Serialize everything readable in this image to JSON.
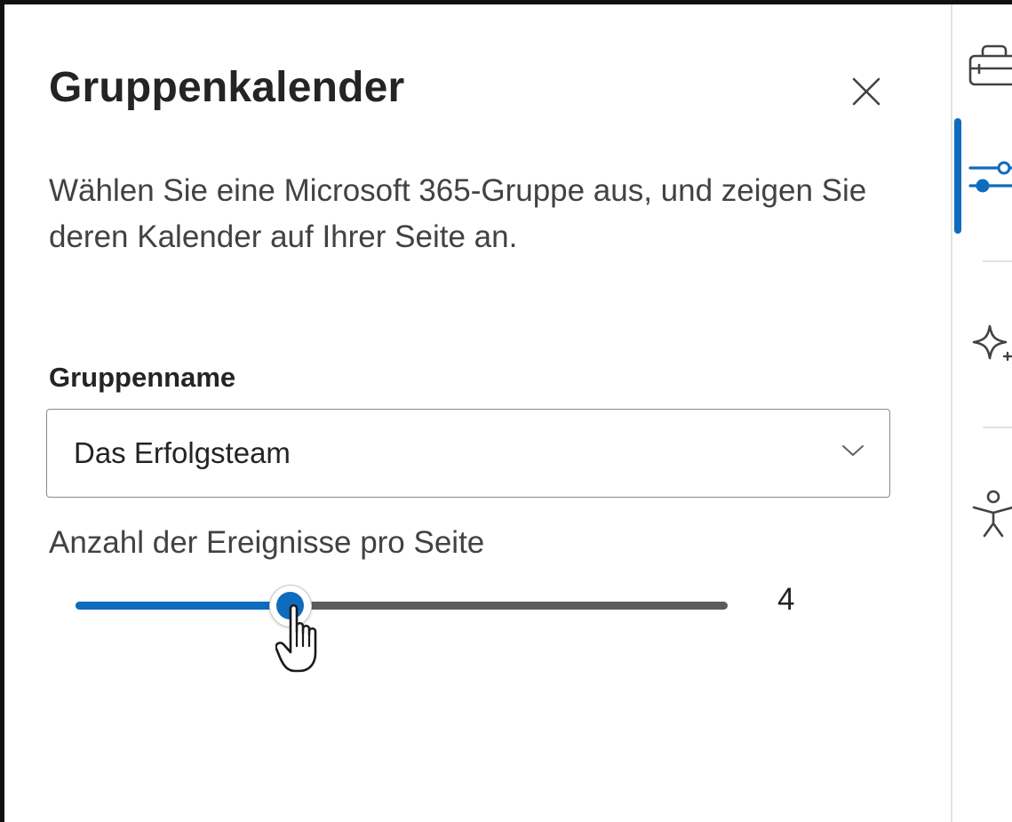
{
  "panel": {
    "title": "Gruppenkalender",
    "description": "Wählen Sie eine Microsoft 365-Gruppe aus, und zeigen Sie deren Kalender auf Ihrer Seite an.",
    "close_icon": "close-icon"
  },
  "group_field": {
    "label": "Gruppenname",
    "value": "Das Erfolgsteam",
    "icon": "chevron-down-icon"
  },
  "events_per_page": {
    "label": "Anzahl der Ereignisse pro Seite",
    "value": "4",
    "fill_fraction": 0.33
  },
  "side_rail": {
    "icons": [
      "toolbox-icon",
      "settings-sliders-icon",
      "sparkle-icon",
      "accessibility-icon"
    ],
    "selected": "settings-sliders-icon"
  },
  "colors": {
    "accent": "#0f6cbd",
    "rail_track": "#5c5c5c",
    "text": "#242424"
  }
}
